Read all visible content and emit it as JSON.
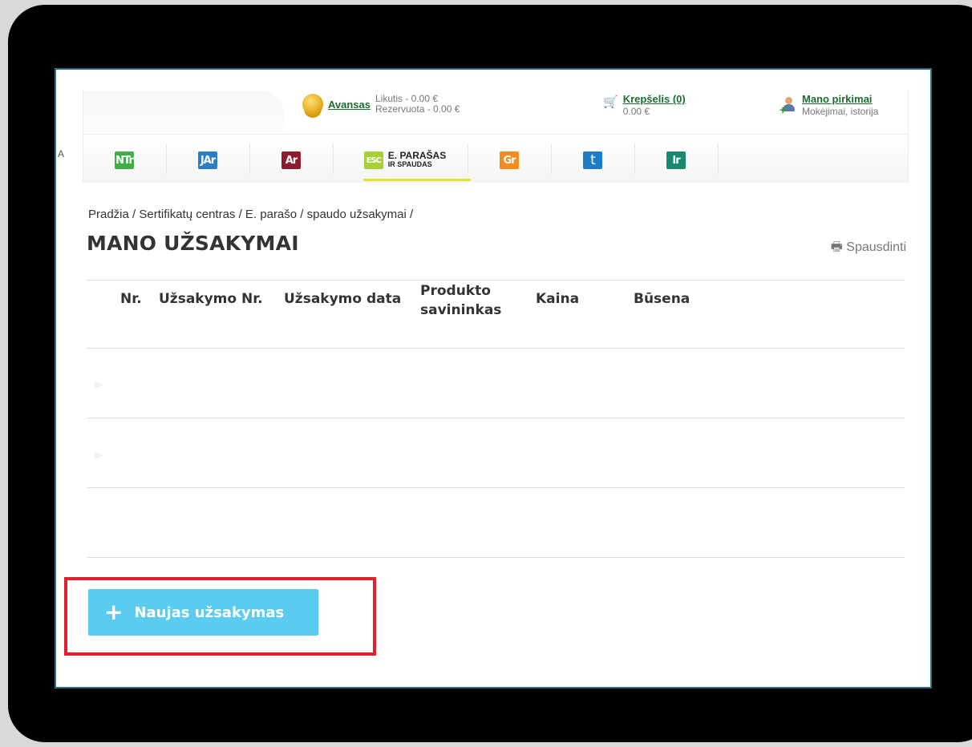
{
  "header": {
    "balance": {
      "link": "Avansas",
      "likutis": "Likutis - 0.00 €",
      "rezervuota": "Rezervuota - 0.00 €"
    },
    "cart": {
      "link": "Krepšelis (0)",
      "sum": "0.00 €"
    },
    "purchases": {
      "link": "Mano pirkimai",
      "sub": "Mokėjimai, istorija"
    },
    "left_letter": "A"
  },
  "nav": {
    "items": [
      {
        "logo": "NTr",
        "color": "#3fae49"
      },
      {
        "logo": "JAr",
        "color": "#2b7dc5"
      },
      {
        "logo": "Ar",
        "color": "#8e1b2f"
      },
      {
        "logo": "ESC",
        "color": "#a7cf38",
        "label1": "E. PARAŠAS",
        "label2": "IR SPAUDAS",
        "active": true
      },
      {
        "logo": "Gr",
        "color": "#f28c1e"
      },
      {
        "logo": "t",
        "color": "#1c7cc9"
      },
      {
        "logo": "Ir",
        "color": "#1a8a6e"
      }
    ]
  },
  "breadcrumb": "Pradžia / Sertifikatų centras / E. parašo / spaudo užsakymai /",
  "page_title": "MANO UŽSAKYMAI",
  "print_label": "Spausdinti",
  "table": {
    "headers": [
      "Nr.",
      "Užsakymo Nr.",
      "Užsakymo data",
      "Produkto savininkas",
      "Kaina",
      "Būsena"
    ]
  },
  "new_order_button": "Naujas užsakymas"
}
